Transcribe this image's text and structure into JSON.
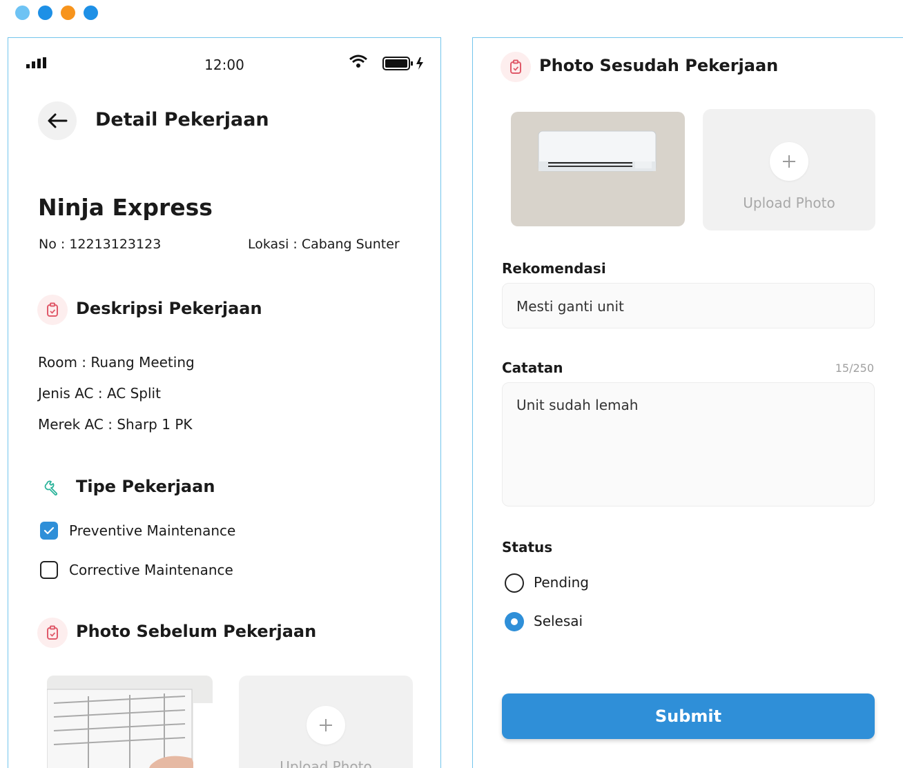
{
  "colors": {
    "dot1": "#6ec3f4",
    "dot2": "#1e90e6",
    "dot3": "#f7941d",
    "dot4": "#1e90e6",
    "frame_border": "#72c4ec",
    "accent": "#2f8fd8",
    "section_icon_bg": "#fdeeee"
  },
  "status_bar": {
    "time": "12:00"
  },
  "header": {
    "title": "Detail Pekerjaan"
  },
  "job": {
    "company": "Ninja Express",
    "number": "No : 12213123123",
    "location": "Lokasi : Cabang Sunter"
  },
  "description": {
    "title": "Deskripsi Pekerjaan",
    "room": "Room : Ruang Meeting",
    "ac_type": "Jenis AC : AC Split",
    "ac_brand": "Merek AC : Sharp 1 PK"
  },
  "work_type": {
    "title": "Tipe Pekerjaan",
    "options": [
      {
        "label": "Preventive Maintenance",
        "checked": true
      },
      {
        "label": "Corrective Maintenance",
        "checked": false
      }
    ]
  },
  "photo_before": {
    "title": "Photo Sebelum Pekerjaan",
    "upload_label": "Upload Photo"
  },
  "photo_after": {
    "title": "Photo Sesudah Pekerjaan",
    "upload_label": "Upload Photo"
  },
  "form": {
    "recommendation_label": "Rekomendasi",
    "recommendation_value": "Mesti ganti unit",
    "notes_label": "Catatan",
    "notes_counter": "15/250",
    "notes_value": "Unit sudah lemah",
    "status_label": "Status",
    "status_options": [
      {
        "label": "Pending",
        "selected": false
      },
      {
        "label": "Selesai",
        "selected": true
      }
    ],
    "submit_label": "Submit"
  }
}
